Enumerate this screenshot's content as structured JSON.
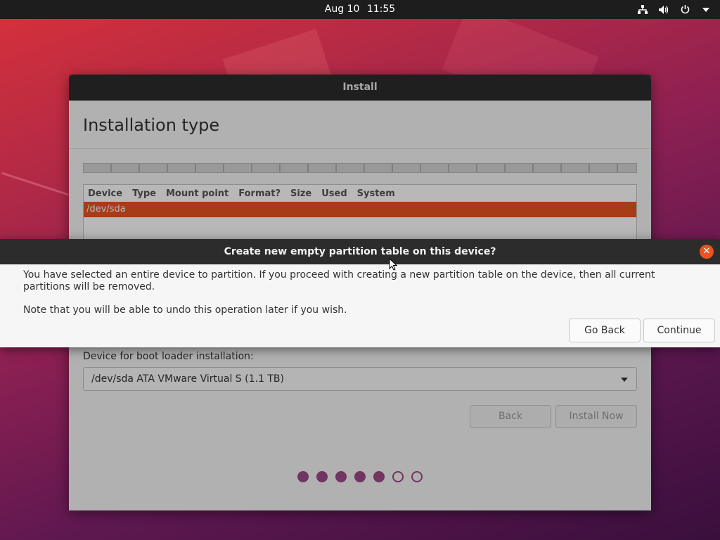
{
  "topbar": {
    "date": "Aug 10",
    "time": "11:55",
    "icons": [
      "network-icon",
      "volume-icon",
      "power-icon",
      "chevron-down-icon"
    ]
  },
  "install_window": {
    "title": "Install",
    "heading": "Installation type",
    "table": {
      "columns": [
        "Device",
        "Type",
        "Mount point",
        "Format?",
        "Size",
        "Used",
        "System"
      ],
      "rows": [
        {
          "device": "/dev/sda"
        }
      ]
    },
    "boot_loader": {
      "label": "Device for boot loader installation:",
      "selected": "/dev/sda ATA VMware Virtual S (1.1 TB)"
    },
    "buttons": {
      "back": "Back",
      "install_now": "Install Now"
    },
    "progress": {
      "total_steps": 7,
      "completed_steps": 5
    }
  },
  "dialog": {
    "title": "Create new empty partition table on this device?",
    "message": "You have selected an entire device to partition. If you proceed with creating a new partition table on the device, then all current partitions will be removed.",
    "note": "Note that you will be able to undo this operation later if you wish.",
    "buttons": {
      "go_back": "Go Back",
      "continue": "Continue"
    }
  },
  "colors": {
    "accent": "#e95420",
    "progress_dot": "#9b4a86",
    "titlebar": "#2c2c2c"
  }
}
